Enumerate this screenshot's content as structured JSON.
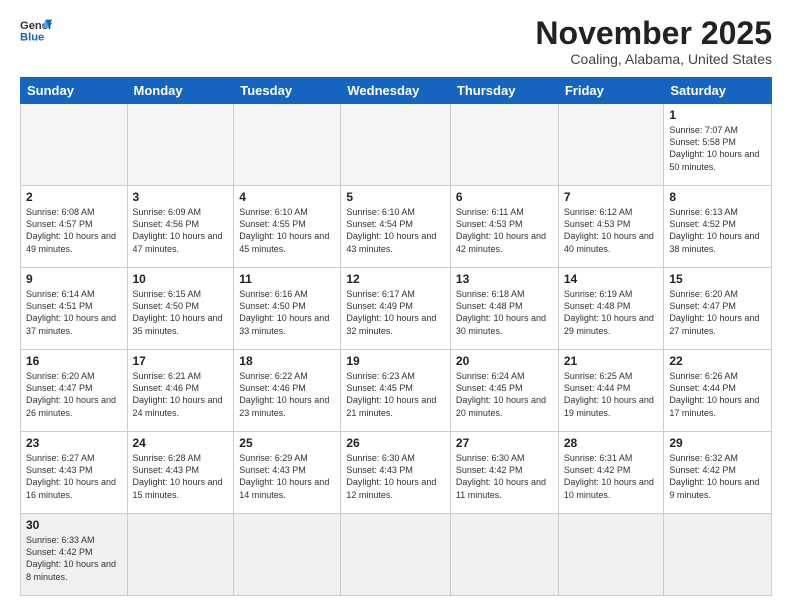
{
  "header": {
    "logo_general": "General",
    "logo_blue": "Blue",
    "month_year": "November 2025",
    "location": "Coaling, Alabama, United States"
  },
  "days_of_week": [
    "Sunday",
    "Monday",
    "Tuesday",
    "Wednesday",
    "Thursday",
    "Friday",
    "Saturday"
  ],
  "weeks": [
    [
      {
        "day": "",
        "info": ""
      },
      {
        "day": "",
        "info": ""
      },
      {
        "day": "",
        "info": ""
      },
      {
        "day": "",
        "info": ""
      },
      {
        "day": "",
        "info": ""
      },
      {
        "day": "",
        "info": ""
      },
      {
        "day": "1",
        "info": "Sunrise: 7:07 AM\nSunset: 5:58 PM\nDaylight: 10 hours\nand 50 minutes."
      }
    ],
    [
      {
        "day": "2",
        "info": "Sunrise: 6:08 AM\nSunset: 4:57 PM\nDaylight: 10 hours\nand 49 minutes."
      },
      {
        "day": "3",
        "info": "Sunrise: 6:09 AM\nSunset: 4:56 PM\nDaylight: 10 hours\nand 47 minutes."
      },
      {
        "day": "4",
        "info": "Sunrise: 6:10 AM\nSunset: 4:55 PM\nDaylight: 10 hours\nand 45 minutes."
      },
      {
        "day": "5",
        "info": "Sunrise: 6:10 AM\nSunset: 4:54 PM\nDaylight: 10 hours\nand 43 minutes."
      },
      {
        "day": "6",
        "info": "Sunrise: 6:11 AM\nSunset: 4:53 PM\nDaylight: 10 hours\nand 42 minutes."
      },
      {
        "day": "7",
        "info": "Sunrise: 6:12 AM\nSunset: 4:53 PM\nDaylight: 10 hours\nand 40 minutes."
      },
      {
        "day": "8",
        "info": "Sunrise: 6:13 AM\nSunset: 4:52 PM\nDaylight: 10 hours\nand 38 minutes."
      }
    ],
    [
      {
        "day": "9",
        "info": "Sunrise: 6:14 AM\nSunset: 4:51 PM\nDaylight: 10 hours\nand 37 minutes."
      },
      {
        "day": "10",
        "info": "Sunrise: 6:15 AM\nSunset: 4:50 PM\nDaylight: 10 hours\nand 35 minutes."
      },
      {
        "day": "11",
        "info": "Sunrise: 6:16 AM\nSunset: 4:50 PM\nDaylight: 10 hours\nand 33 minutes."
      },
      {
        "day": "12",
        "info": "Sunrise: 6:17 AM\nSunset: 4:49 PM\nDaylight: 10 hours\nand 32 minutes."
      },
      {
        "day": "13",
        "info": "Sunrise: 6:18 AM\nSunset: 4:48 PM\nDaylight: 10 hours\nand 30 minutes."
      },
      {
        "day": "14",
        "info": "Sunrise: 6:19 AM\nSunset: 4:48 PM\nDaylight: 10 hours\nand 29 minutes."
      },
      {
        "day": "15",
        "info": "Sunrise: 6:20 AM\nSunset: 4:47 PM\nDaylight: 10 hours\nand 27 minutes."
      }
    ],
    [
      {
        "day": "16",
        "info": "Sunrise: 6:20 AM\nSunset: 4:47 PM\nDaylight: 10 hours\nand 26 minutes."
      },
      {
        "day": "17",
        "info": "Sunrise: 6:21 AM\nSunset: 4:46 PM\nDaylight: 10 hours\nand 24 minutes."
      },
      {
        "day": "18",
        "info": "Sunrise: 6:22 AM\nSunset: 4:46 PM\nDaylight: 10 hours\nand 23 minutes."
      },
      {
        "day": "19",
        "info": "Sunrise: 6:23 AM\nSunset: 4:45 PM\nDaylight: 10 hours\nand 21 minutes."
      },
      {
        "day": "20",
        "info": "Sunrise: 6:24 AM\nSunset: 4:45 PM\nDaylight: 10 hours\nand 20 minutes."
      },
      {
        "day": "21",
        "info": "Sunrise: 6:25 AM\nSunset: 4:44 PM\nDaylight: 10 hours\nand 19 minutes."
      },
      {
        "day": "22",
        "info": "Sunrise: 6:26 AM\nSunset: 4:44 PM\nDaylight: 10 hours\nand 17 minutes."
      }
    ],
    [
      {
        "day": "23",
        "info": "Sunrise: 6:27 AM\nSunset: 4:43 PM\nDaylight: 10 hours\nand 16 minutes."
      },
      {
        "day": "24",
        "info": "Sunrise: 6:28 AM\nSunset: 4:43 PM\nDaylight: 10 hours\nand 15 minutes."
      },
      {
        "day": "25",
        "info": "Sunrise: 6:29 AM\nSunset: 4:43 PM\nDaylight: 10 hours\nand 14 minutes."
      },
      {
        "day": "26",
        "info": "Sunrise: 6:30 AM\nSunset: 4:43 PM\nDaylight: 10 hours\nand 12 minutes."
      },
      {
        "day": "27",
        "info": "Sunrise: 6:30 AM\nSunset: 4:42 PM\nDaylight: 10 hours\nand 11 minutes."
      },
      {
        "day": "28",
        "info": "Sunrise: 6:31 AM\nSunset: 4:42 PM\nDaylight: 10 hours\nand 10 minutes."
      },
      {
        "day": "29",
        "info": "Sunrise: 6:32 AM\nSunset: 4:42 PM\nDaylight: 10 hours\nand 9 minutes."
      }
    ],
    [
      {
        "day": "30",
        "info": "Sunrise: 6:33 AM\nSunset: 4:42 PM\nDaylight: 10 hours\nand 8 minutes."
      },
      {
        "day": "",
        "info": ""
      },
      {
        "day": "",
        "info": ""
      },
      {
        "day": "",
        "info": ""
      },
      {
        "day": "",
        "info": ""
      },
      {
        "day": "",
        "info": ""
      },
      {
        "day": "",
        "info": ""
      }
    ]
  ]
}
